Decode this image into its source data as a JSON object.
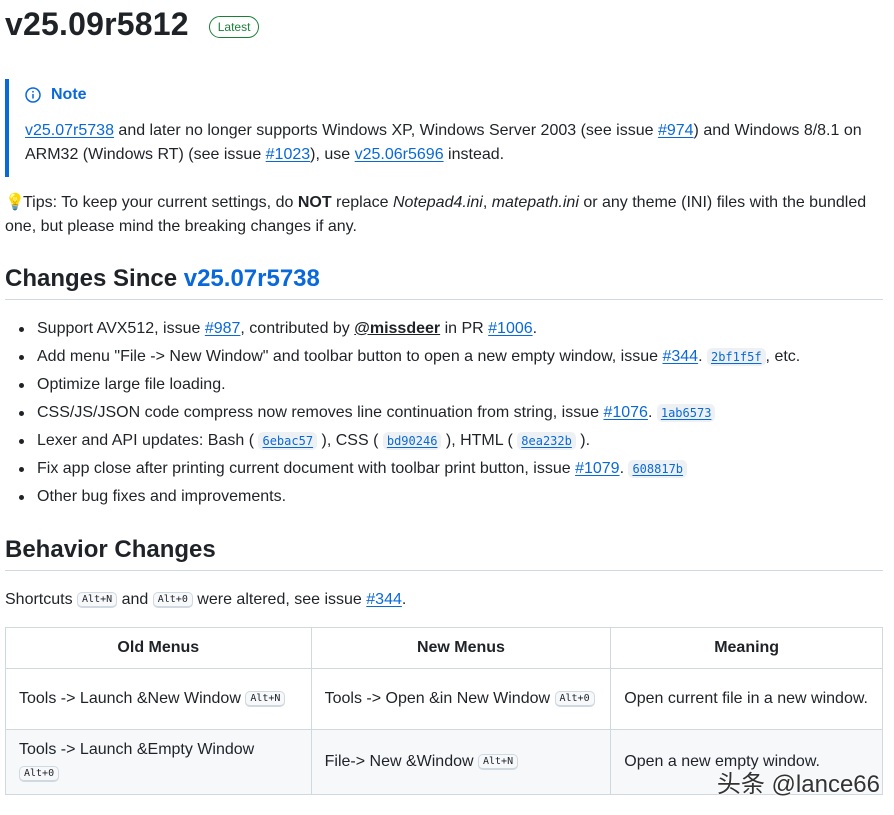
{
  "release": {
    "title": "v25.09r5812",
    "badge": "Latest"
  },
  "note": {
    "heading": "Note",
    "link1": "v25.07r5738",
    "text1": " and later no longer supports Windows XP, Windows Server 2003 (see issue ",
    "link2": "#974",
    "text2": ") and Windows 8/8.1 on ARM32 (Windows RT) (see issue ",
    "link3": "#1023",
    "text3": "), use ",
    "link4": "v25.06r5696",
    "text4": " instead."
  },
  "tips": {
    "text1": "Tips: To keep your current settings, do ",
    "bold": "NOT",
    "text2": " replace ",
    "file1": "Notepad4.ini",
    "sep": ", ",
    "file2": "matepath.ini",
    "text3": " or any theme (INI) files with the bundled one, but please mind the breaking changes if any."
  },
  "changes": {
    "heading_prefix": "Changes Since ",
    "heading_link": "v25.07r5738",
    "items": [
      {
        "t1": "Support AVX512, issue ",
        "l1": "#987",
        "t2": ", contributed by ",
        "mention": "@missdeer",
        "t3": " in PR ",
        "l2": "#1006",
        "t4": "."
      },
      {
        "t1": "Add menu \"File -> New Window\" and toolbar button to open a new empty window, issue ",
        "l1": "#344",
        "t2": ". ",
        "c1": "2bf1f5f",
        "t3": ", etc."
      },
      {
        "t1": "Optimize large file loading."
      },
      {
        "t1": "CSS/JS/JSON code compress now removes line continuation from string, issue ",
        "l1": "#1076",
        "t2": ". ",
        "c1": "1ab6573"
      },
      {
        "t1": "Lexer and API updates: Bash ( ",
        "c1": "6ebac57",
        "t2": " ), CSS ( ",
        "c2": "bd90246",
        "t3": " ), HTML ( ",
        "c3": "8ea232b",
        "t4": " )."
      },
      {
        "t1": "Fix app close after printing current document with toolbar print button, issue ",
        "l1": "#1079",
        "t2": ". ",
        "c1": "608817b"
      },
      {
        "t1": "Other bug fixes and improvements."
      }
    ]
  },
  "behavior": {
    "heading": "Behavior Changes",
    "shortcuts": {
      "t1": "Shortcuts ",
      "k1": "Alt+N",
      "t2": " and ",
      "k2": "Alt+0",
      "t3": " were altered, see issue ",
      "l1": "#344",
      "t4": "."
    },
    "table": {
      "headers": [
        "Old Menus",
        "New Menus",
        "Meaning"
      ],
      "rows": [
        {
          "old": "Tools -> Launch &New Window ",
          "old_key": "Alt+N",
          "new": "Tools -> Open &in New Window ",
          "new_key": "Alt+0",
          "meaning": "Open current file in a new window."
        },
        {
          "old": "Tools -> Launch &Empty Window ",
          "old_key": "Alt+0",
          "new": "File-> New &Window ",
          "new_key": "Alt+N",
          "meaning": "Open a new empty window."
        }
      ]
    }
  },
  "watermark": "头条 @lance66",
  "colors": {
    "link": "#0969da",
    "badge": "#1a7f37",
    "text": "#1f2328"
  }
}
